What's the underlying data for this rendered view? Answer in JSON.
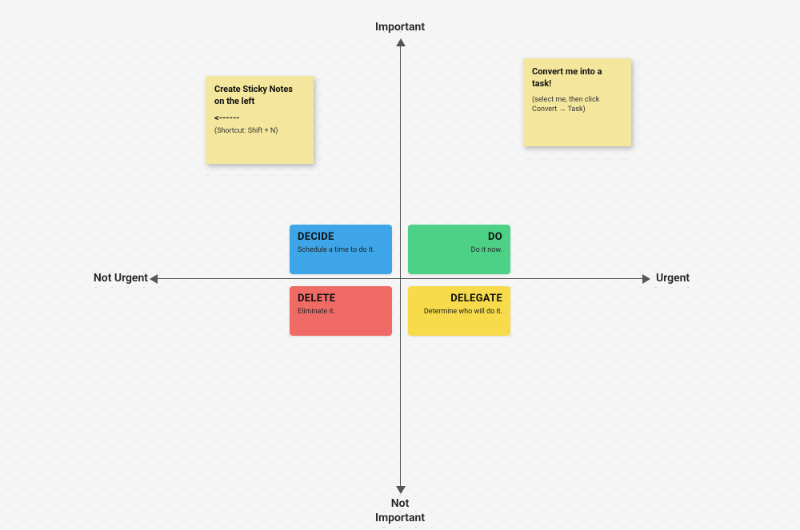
{
  "axes": {
    "top": "Important",
    "bottom": "Not\nImportant",
    "left": "Not Urgent",
    "right": "Urgent"
  },
  "quadrants": {
    "decide": {
      "title": "DECIDE",
      "desc": "Schedule a time to do it."
    },
    "do": {
      "title": "DO",
      "desc": "Do it now."
    },
    "delete": {
      "title": "DELETE",
      "desc": "Eliminate it."
    },
    "delegate": {
      "title": "DELEGATE",
      "desc": "Determine who will do it."
    }
  },
  "stickies": {
    "left": {
      "headline": "Create Sticky Notes on the left",
      "arrow": "<------",
      "hint": "(Shortcut: Shift + N)"
    },
    "right": {
      "headline": "Convert me into a task!",
      "hint": "(select me, then click Convert → Task)"
    }
  }
}
